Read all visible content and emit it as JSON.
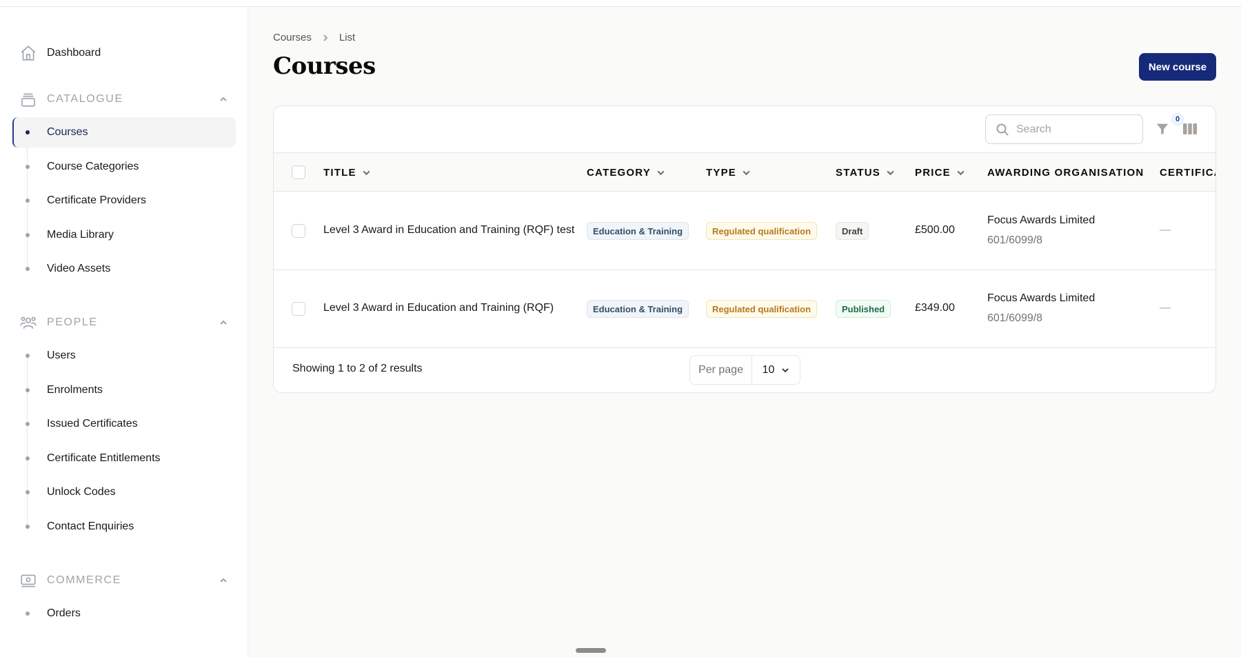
{
  "sidebar": {
    "dashboard_label": "Dashboard",
    "groups": [
      {
        "label": "CATALOGUE",
        "items": [
          "Courses",
          "Course Categories",
          "Certificate Providers",
          "Media Library",
          "Video Assets"
        ]
      },
      {
        "label": "PEOPLE",
        "items": [
          "Users",
          "Enrolments",
          "Issued Certificates",
          "Certificate Entitlements",
          "Unlock Codes",
          "Contact Enquiries"
        ]
      },
      {
        "label": "COMMERCE",
        "items": [
          "Orders"
        ]
      }
    ],
    "active_item": "Courses"
  },
  "breadcrumb": [
    "Courses",
    "List"
  ],
  "page_title": "Courses",
  "new_button_label": "New course",
  "toolbar": {
    "search_placeholder": "Search",
    "filter_count": "0"
  },
  "table": {
    "columns": [
      "TITLE",
      "CATEGORY",
      "TYPE",
      "STATUS",
      "PRICE",
      "AWARDING ORGANISATION",
      "CERTIFICA"
    ],
    "rows": [
      {
        "title": "Level 3 Award in Education and Training (RQF) test",
        "category": "Education & Training",
        "type": "Regulated qualification",
        "status": "Draft",
        "price": "£500.00",
        "org": "Focus Awards Limited",
        "org_code": "601/6099/8",
        "certificate": "—"
      },
      {
        "title": "Level 3 Award in Education and Training (RQF)",
        "category": "Education & Training",
        "type": "Regulated qualification",
        "status": "Published",
        "price": "£349.00",
        "org": "Focus Awards Limited",
        "org_code": "601/6099/8",
        "certificate": "—"
      }
    ]
  },
  "footer": {
    "showing": "Showing 1 to 2 of 2 results",
    "per_page_label": "Per page",
    "per_page_value": "10"
  },
  "colors": {
    "accent": "#172a7a",
    "active_text": "#172554"
  },
  "icons": {
    "dashboard": "home-icon",
    "catalogue": "archive-icon",
    "people": "users-icon",
    "commerce": "banknote-icon"
  }
}
